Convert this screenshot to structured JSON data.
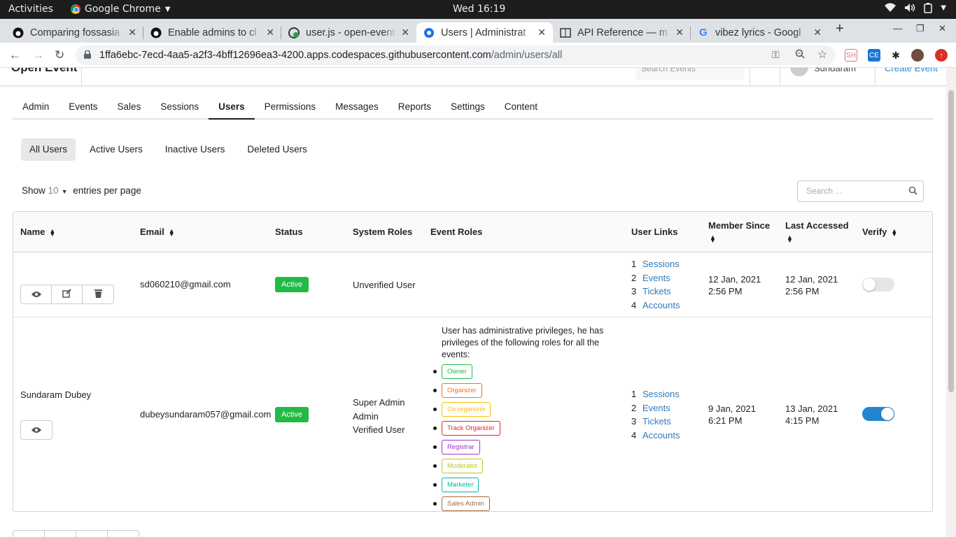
{
  "system": {
    "activities": "Activities",
    "app_name": "Google Chrome",
    "clock": "Wed 16:19"
  },
  "tabs": [
    {
      "title": "Comparing fossasia",
      "icon": "github-icon"
    },
    {
      "title": "Enable admins to cl",
      "icon": "github-icon"
    },
    {
      "title": "user.js - open-event",
      "icon": "codespaces-icon"
    },
    {
      "title": "Users | Administrat",
      "icon": "open-event-icon",
      "active": true
    },
    {
      "title": "API Reference — m",
      "icon": "docs-icon"
    },
    {
      "title": "vibez lyrics - Googl",
      "icon": "google-icon"
    }
  ],
  "browser": {
    "url_host": "1ffa6ebc-7ecd-4aa5-a2f3-4bff12696ea3-4200.apps.codespaces.githubusercontent.com",
    "url_path": "/admin/users/all"
  },
  "app_header": {
    "brand": "Open Event",
    "search_placeholder": "Search Events",
    "user": "Sundaram",
    "create": "Create Event"
  },
  "menu": [
    "Admin",
    "Events",
    "Sales",
    "Sessions",
    "Users",
    "Permissions",
    "Messages",
    "Reports",
    "Settings",
    "Content"
  ],
  "active_menu": "Users",
  "submenu": [
    "All Users",
    "Active Users",
    "Inactive Users",
    "Deleted Users"
  ],
  "entries": {
    "show": "Show",
    "count": "10",
    "suffix": "entries per page"
  },
  "table_search_placeholder": "Search ...",
  "columns": {
    "name": "Name",
    "email": "Email",
    "status": "Status",
    "system_roles": "System Roles",
    "event_roles": "Event Roles",
    "user_links": "User Links",
    "member_since": "Member Since",
    "last_accessed": "Last Accessed",
    "verify": "Verify"
  },
  "link_labels": [
    "Sessions",
    "Events",
    "Tickets",
    "Accounts"
  ],
  "link_numbers": [
    "1",
    "2",
    "3",
    "4"
  ],
  "users": [
    {
      "name": "",
      "email": "sd060210@gmail.com",
      "status": "Active",
      "system_roles": [
        "Unverified User"
      ],
      "member_since": [
        "12 Jan, 2021",
        "2:56 PM"
      ],
      "last_accessed": [
        "12 Jan, 2021",
        "2:56 PM"
      ],
      "verified": false
    },
    {
      "name": "Sundaram Dubey",
      "email": "dubeysundaram057@gmail.com",
      "status": "Active",
      "system_roles": [
        "Super Admin",
        "Admin",
        "Verified User"
      ],
      "event_roles_desc": "User has administrative privileges, he has privileges of the following roles for all the events:",
      "event_roles": [
        {
          "label": "Owner",
          "color": "#21ba45"
        },
        {
          "label": "Organizer",
          "color": "#f2711c"
        },
        {
          "label": "Co organizer",
          "color": "#fbbd08"
        },
        {
          "label": "Track Organizer",
          "color": "#db2828"
        },
        {
          "label": "Registrar",
          "color": "#a333c8"
        },
        {
          "label": "Moderator",
          "color": "#b5cc18"
        },
        {
          "label": "Marketer",
          "color": "#00b5ad"
        },
        {
          "label": "Sales Admin",
          "color": "#a5673f"
        }
      ],
      "member_since": [
        "9 Jan, 2021",
        "6:21 PM"
      ],
      "last_accessed": [
        "13 Jan, 2021",
        "4:15 PM"
      ],
      "verified": true
    }
  ],
  "colors": {
    "accent": "#2185d0",
    "link": "#2f7bbf",
    "active_badge": "#21ba45"
  }
}
